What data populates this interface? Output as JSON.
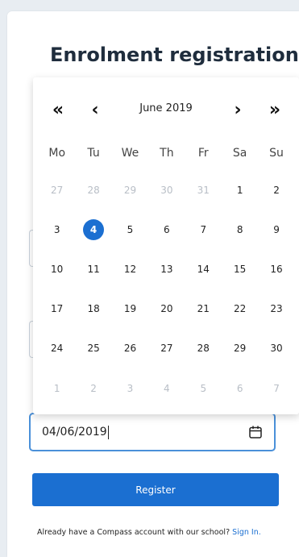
{
  "page": {
    "title": "Enrolment registration"
  },
  "form": {
    "date_value": "04/06/2019",
    "register_label": "Register",
    "signin_text": "Already have a Compass account with our school?",
    "signin_link": "Sign In."
  },
  "calendar": {
    "month_label": "June 2019",
    "nav": {
      "prev_year": "«",
      "prev_month": "‹",
      "next_month": "›",
      "next_year": "»"
    },
    "weekdays": [
      "Mo",
      "Tu",
      "We",
      "Th",
      "Fr",
      "Sa",
      "Su"
    ],
    "weeks": [
      [
        {
          "d": "27",
          "m": true
        },
        {
          "d": "28",
          "m": true
        },
        {
          "d": "29",
          "m": true
        },
        {
          "d": "30",
          "m": true
        },
        {
          "d": "31",
          "m": true
        },
        {
          "d": "1"
        },
        {
          "d": "2"
        }
      ],
      [
        {
          "d": "3"
        },
        {
          "d": "4",
          "s": true
        },
        {
          "d": "5"
        },
        {
          "d": "6"
        },
        {
          "d": "7"
        },
        {
          "d": "8"
        },
        {
          "d": "9"
        }
      ],
      [
        {
          "d": "10"
        },
        {
          "d": "11"
        },
        {
          "d": "12"
        },
        {
          "d": "13"
        },
        {
          "d": "14"
        },
        {
          "d": "15"
        },
        {
          "d": "16"
        }
      ],
      [
        {
          "d": "17"
        },
        {
          "d": "18"
        },
        {
          "d": "19"
        },
        {
          "d": "20"
        },
        {
          "d": "21"
        },
        {
          "d": "22"
        },
        {
          "d": "23"
        }
      ],
      [
        {
          "d": "24"
        },
        {
          "d": "25"
        },
        {
          "d": "26"
        },
        {
          "d": "27"
        },
        {
          "d": "28"
        },
        {
          "d": "29"
        },
        {
          "d": "30"
        }
      ],
      [
        {
          "d": "1",
          "m": true
        },
        {
          "d": "2",
          "m": true
        },
        {
          "d": "3",
          "m": true
        },
        {
          "d": "4",
          "m": true
        },
        {
          "d": "5",
          "m": true
        },
        {
          "d": "6",
          "m": true
        },
        {
          "d": "7",
          "m": true
        }
      ]
    ]
  },
  "icons": {
    "date_picker": "calendar-icon"
  },
  "colors": {
    "accent": "#1b6fd1",
    "focus_border": "#4a90d9",
    "title": "#1f2d3d"
  }
}
